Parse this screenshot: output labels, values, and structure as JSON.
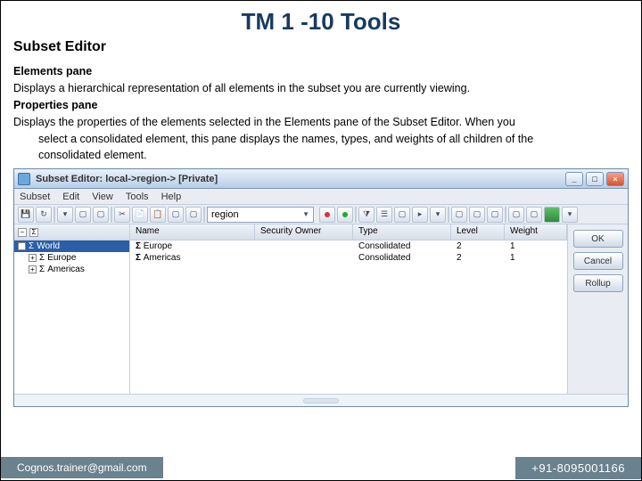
{
  "slide": {
    "title": "TM 1 -10 Tools",
    "subtitle": "Subset Editor"
  },
  "text": {
    "h1": "Elements pane",
    "p1": "Displays a hierarchical representation of all elements in the subset you are currently viewing.",
    "h2": "Properties pane",
    "p2a": "Displays the properties of the elements selected in the Elements pane of the Subset Editor. When you",
    "p2b": "select a consolidated element, this pane displays the names, types, and weights of all children of the",
    "p2c": "consolidated element."
  },
  "app": {
    "titlebar": "Subset Editor:  local->region->  [Private]",
    "menu": [
      "Subset",
      "Edit",
      "View",
      "Tools",
      "Help"
    ],
    "dropdownValue": "region",
    "tree": {
      "root": "World",
      "items": [
        "Europe",
        "Americas"
      ],
      "expander": "+",
      "rootExpander": "−"
    },
    "columns": {
      "name": "Name",
      "security": "Security Owner",
      "type": "Type",
      "level": "Level",
      "weight": "Weight"
    },
    "rows": [
      {
        "sigma": "Σ",
        "name": "Europe",
        "type": "Consolidated",
        "level": "2",
        "weight": "1"
      },
      {
        "sigma": "Σ",
        "name": "Americas",
        "type": "Consolidated",
        "level": "2",
        "weight": "1"
      }
    ],
    "buttons": {
      "ok": "OK",
      "cancel": "Cancel",
      "rollup": "Rollup"
    },
    "winbtns": {
      "min": "_",
      "max": "□",
      "close": "×"
    }
  },
  "footer": {
    "email": "Cognos.trainer@gmail.com",
    "phone": "+91-8095001166"
  }
}
